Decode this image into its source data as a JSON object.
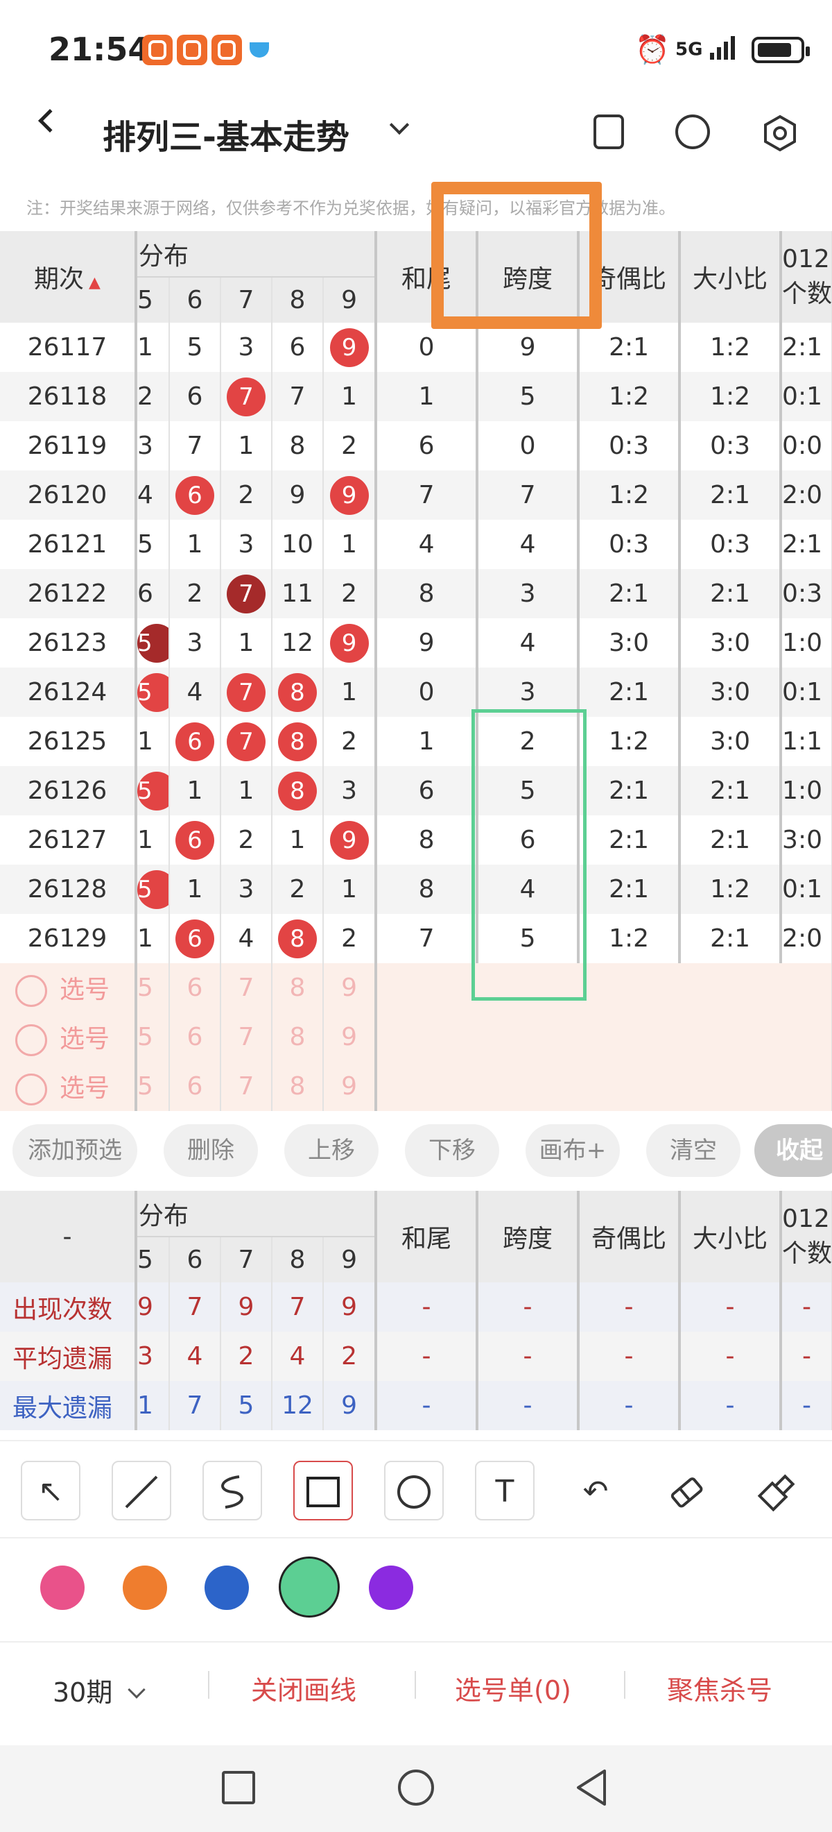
{
  "status": {
    "time": "21:54",
    "network": "5G"
  },
  "header": {
    "title": "排列三-基本走势"
  },
  "notice": "注：开奖结果来源于网络，仅供参考不作为兑奖依据，如有疑问，以福彩官方数据为准。",
  "table": {
    "period_header": "期次",
    "dist_header": "分布",
    "digits": [
      "5",
      "6",
      "7",
      "8",
      "9"
    ],
    "cols": [
      "和尾",
      "跨度",
      "奇偶比",
      "大小比",
      "012"
    ],
    "col_extra": "个数",
    "rows": [
      {
        "period": "26117",
        "cells": [
          "1",
          "5",
          "3",
          "6",
          "9"
        ],
        "hw": "0",
        "kd": "9",
        "jo": "2:1",
        "dx": "1:2",
        "l": "2:1"
      },
      {
        "period": "26118",
        "cells": [
          "2",
          "6",
          "7",
          "7",
          "1"
        ],
        "hw": "1",
        "kd": "5",
        "jo": "1:2",
        "dx": "1:2",
        "l": "0:1"
      },
      {
        "period": "26119",
        "cells": [
          "3",
          "7",
          "1",
          "8",
          "2"
        ],
        "hw": "6",
        "kd": "0",
        "jo": "0:3",
        "dx": "0:3",
        "l": "0:0"
      },
      {
        "period": "26120",
        "cells": [
          "4",
          "6",
          "2",
          "9",
          "9"
        ],
        "hw": "7",
        "kd": "7",
        "jo": "1:2",
        "dx": "2:1",
        "l": "2:0"
      },
      {
        "period": "26121",
        "cells": [
          "5",
          "1",
          "3",
          "10",
          "1"
        ],
        "hw": "4",
        "kd": "4",
        "jo": "0:3",
        "dx": "0:3",
        "l": "2:1"
      },
      {
        "period": "26122",
        "cells": [
          "6",
          "2",
          "7",
          "11",
          "2"
        ],
        "hw": "8",
        "kd": "3",
        "jo": "2:1",
        "dx": "2:1",
        "l": "0:3"
      },
      {
        "period": "26123",
        "cells": [
          "5",
          "3",
          "1",
          "12",
          "9"
        ],
        "hw": "9",
        "kd": "4",
        "jo": "3:0",
        "dx": "3:0",
        "l": "1:0"
      },
      {
        "period": "26124",
        "cells": [
          "5",
          "4",
          "7",
          "8",
          "1"
        ],
        "hw": "0",
        "kd": "3",
        "jo": "2:1",
        "dx": "3:0",
        "l": "0:1"
      },
      {
        "period": "26125",
        "cells": [
          "1",
          "6",
          "7",
          "8",
          "2"
        ],
        "hw": "1",
        "kd": "2",
        "jo": "1:2",
        "dx": "3:0",
        "l": "1:1"
      },
      {
        "period": "26126",
        "cells": [
          "5",
          "1",
          "1",
          "8",
          "3"
        ],
        "hw": "6",
        "kd": "5",
        "jo": "2:1",
        "dx": "2:1",
        "l": "1:0"
      },
      {
        "period": "26127",
        "cells": [
          "1",
          "6",
          "2",
          "1",
          "9"
        ],
        "hw": "8",
        "kd": "6",
        "jo": "2:1",
        "dx": "2:1",
        "l": "3:0"
      },
      {
        "period": "26128",
        "cells": [
          "5",
          "1",
          "3",
          "2",
          "1"
        ],
        "hw": "8",
        "kd": "4",
        "jo": "2:1",
        "dx": "1:2",
        "l": "0:1"
      },
      {
        "period": "26129",
        "cells": [
          "1",
          "6",
          "4",
          "8",
          "2"
        ],
        "hw": "7",
        "kd": "5",
        "jo": "1:2",
        "dx": "2:1",
        "l": "2:0"
      }
    ],
    "pick_label": "选号",
    "pick_digits": [
      "5",
      "6",
      "7",
      "8",
      "9"
    ]
  },
  "actions": [
    "添加预选",
    "删除",
    "上移",
    "下移",
    "画布+",
    "清空",
    "收起"
  ],
  "stats": {
    "corner": "-",
    "rows": [
      {
        "label": "出现次数",
        "cells": [
          "9",
          "7",
          "9",
          "7",
          "9"
        ]
      },
      {
        "label": "平均遗漏",
        "cells": [
          "3",
          "4",
          "2",
          "4",
          "2"
        ]
      },
      {
        "label": "最大遗漏",
        "cells": [
          "1",
          "7",
          "5",
          "12",
          "9"
        ]
      }
    ],
    "dash": "-"
  },
  "tools": [
    "arrow-icon",
    "line-icon",
    "curve-icon",
    "rectangle-icon",
    "circle-icon",
    "text-icon",
    "undo-icon",
    "eraser-icon",
    "brush-icon"
  ],
  "colors": [
    "#e9528a",
    "#ef7d2e",
    "#2c64c9",
    "#5ccf93",
    "#8b2be0"
  ],
  "bottom": {
    "period": "30期",
    "close": "关闭画线",
    "selection": "选号单(0)",
    "focus": "聚焦杀号"
  },
  "accent": "#d84b4b"
}
